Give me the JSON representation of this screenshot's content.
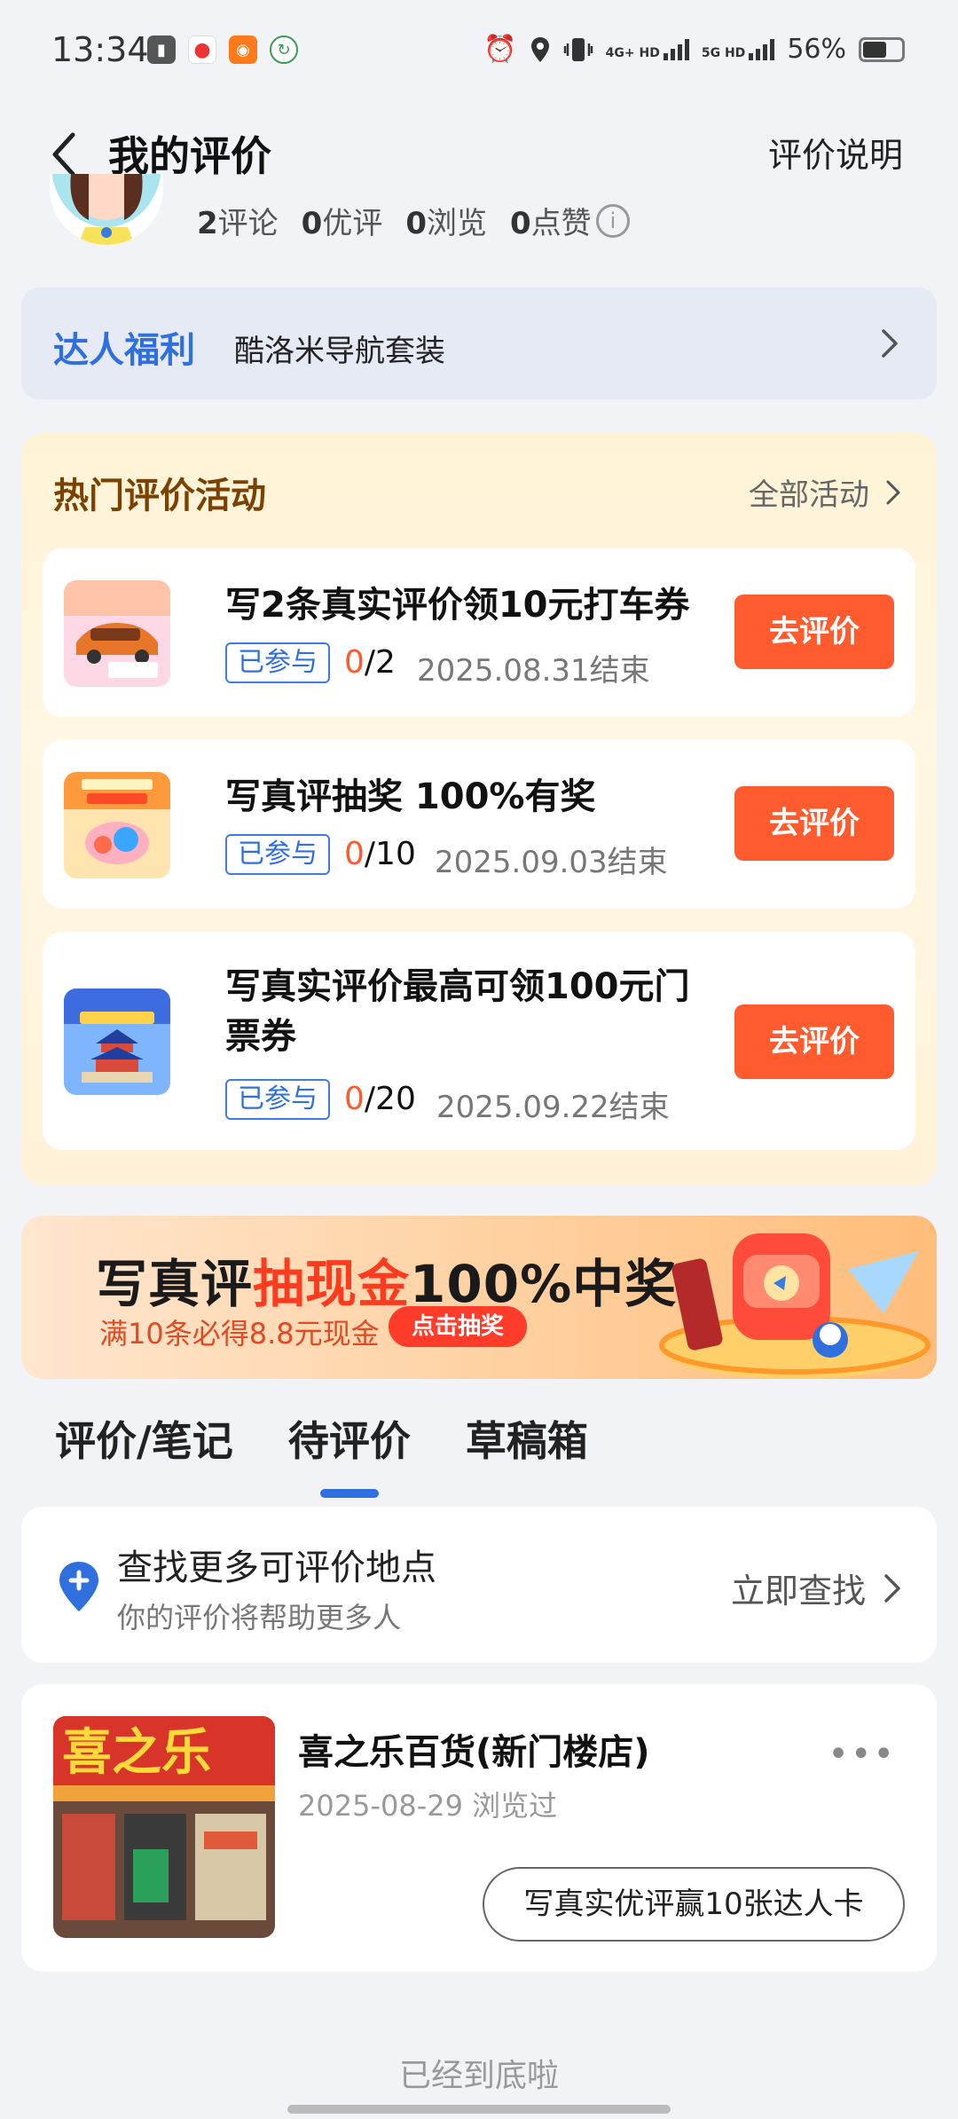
{
  "status_bar": {
    "time": "13:34",
    "net_labels": [
      "4G+ HD",
      "5G HD"
    ],
    "battery": "56%"
  },
  "header": {
    "title": "我的评价",
    "explain_link": "评价说明"
  },
  "stats": [
    {
      "num": "2",
      "label": "评论"
    },
    {
      "num": "0",
      "label": "优评"
    },
    {
      "num": "0",
      "label": "浏览"
    },
    {
      "num": "0",
      "label": "点赞"
    }
  ],
  "perks": {
    "title": "达人福利",
    "desc": "酷洛米导航套装"
  },
  "activities": {
    "title": "热门评价活动",
    "all_link": "全部活动",
    "items": [
      {
        "title": "写2条真实评价领10元打车券",
        "tag": "已参与",
        "current": "0",
        "total": "/2",
        "deadline": "2025.08.31结束",
        "button": "去评价"
      },
      {
        "title": "写真评抽奖 100%有奖",
        "tag": "已参与",
        "current": "0",
        "total": "/10",
        "deadline": "2025.09.03结束",
        "button": "去评价"
      },
      {
        "title": "写真实评价最高可领100元门票券",
        "tag": "已参与",
        "current": "0",
        "total": "/20",
        "deadline": "2025.09.22结束",
        "button": "去评价"
      }
    ]
  },
  "banner": {
    "title_pre": "写真评",
    "title_hl": "抽现金",
    "title_post": "100%中奖",
    "subtitle": "满10条必得8.8元现金",
    "button": "点击抽奖"
  },
  "tabs": [
    "评价/笔记",
    "待评价",
    "草稿箱"
  ],
  "active_tab": "待评价",
  "find_more": {
    "title": "查找更多可评价地点",
    "subtitle": "你的评价将帮助更多人",
    "link": "立即查找"
  },
  "place": {
    "name": "喜之乐百货(新门楼店)",
    "meta": "2025-08-29 浏览过",
    "button": "写真实优评赢10张达人卡",
    "sign_text": "喜之乐"
  },
  "footer": {
    "end_text": "已经到底啦"
  },
  "colors": {
    "accent_blue": "#2f6fde",
    "accent_orange": "#ff5b2e"
  }
}
